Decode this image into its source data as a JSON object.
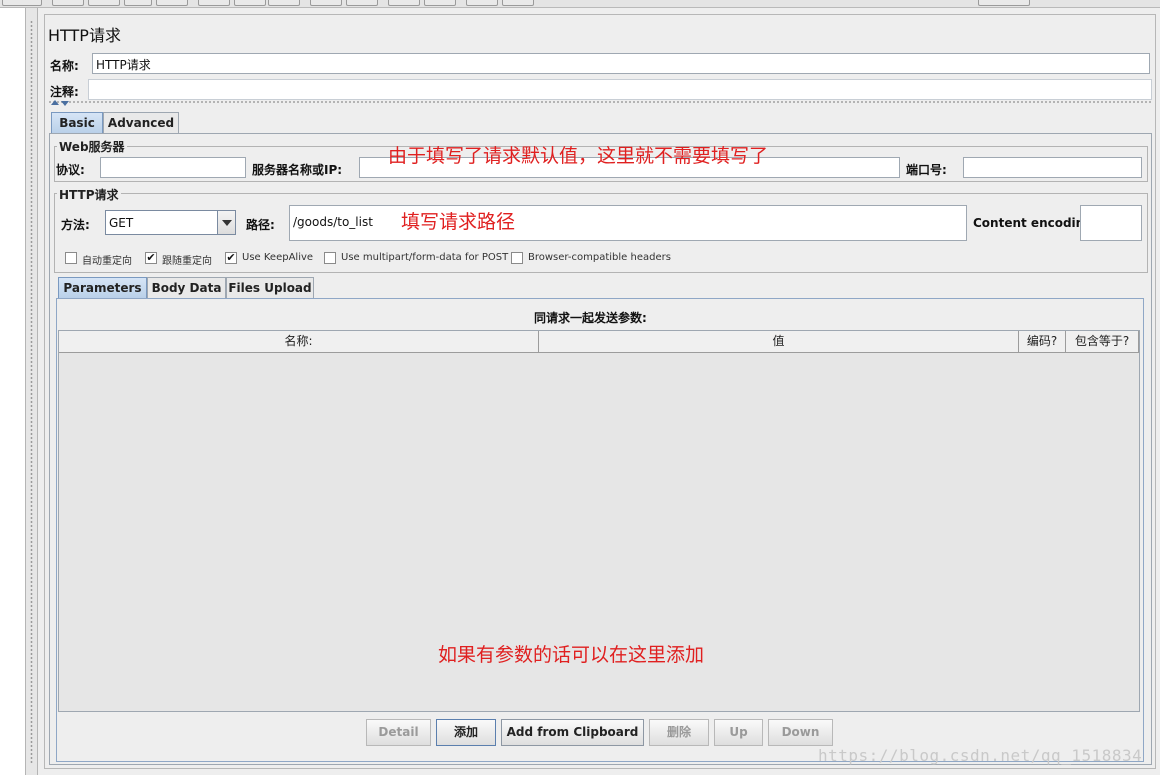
{
  "panel": {
    "title": "HTTP请求",
    "name_label": "名称:",
    "name_value": "HTTP请求",
    "comment_label": "注释:",
    "comment_value": ""
  },
  "tabs": [
    {
      "label": "Basic",
      "active": true
    },
    {
      "label": "Advanced",
      "active": false
    }
  ],
  "web_server": {
    "group_title": "Web服务器",
    "protocol_label": "协议:",
    "protocol_value": "",
    "server_label": "服务器名称或IP:",
    "server_value": "",
    "port_label": "端口号:",
    "port_value": ""
  },
  "http_request": {
    "group_title": "HTTP请求",
    "method_label": "方法:",
    "method_value": "GET",
    "path_label": "路径:",
    "path_value": "/goods/to_list",
    "encoding_label": "Content encoding:",
    "encoding_value": ""
  },
  "checkboxes": [
    {
      "label": "自动重定向",
      "checked": false
    },
    {
      "label": "跟随重定向",
      "checked": true
    },
    {
      "label": "Use KeepAlive",
      "checked": true
    },
    {
      "label": "Use multipart/form-data for POST",
      "checked": false
    },
    {
      "label": "Browser-compatible headers",
      "checked": false
    }
  ],
  "check_mark": "✔",
  "sub_tabs": [
    {
      "label": "Parameters",
      "active": true
    },
    {
      "label": "Body Data",
      "active": false
    },
    {
      "label": "Files Upload",
      "active": false
    }
  ],
  "params_table": {
    "caption": "同请求一起发送参数:",
    "columns": [
      "名称:",
      "值",
      "编码?",
      "包含等于?"
    ],
    "rows": []
  },
  "buttons": [
    {
      "label": "Detail",
      "enabled": false
    },
    {
      "label": "添加",
      "enabled": true
    },
    {
      "label": "Add from Clipboard",
      "enabled": true
    },
    {
      "label": "删除",
      "enabled": false
    },
    {
      "label": "Up",
      "enabled": false
    },
    {
      "label": "Down",
      "enabled": false
    }
  ],
  "annotations": {
    "server_note": "由于填写了请求默认值，这里就不需要填写了",
    "path_note": "填写请求路径",
    "params_note": "如果有参数的话可以在这里添加"
  },
  "watermark": "https://blog.csdn.net/qq_1518834",
  "colors": {
    "annotation": "#e02020",
    "active_tab": "#c7daf0",
    "background": "#eeeeee"
  }
}
